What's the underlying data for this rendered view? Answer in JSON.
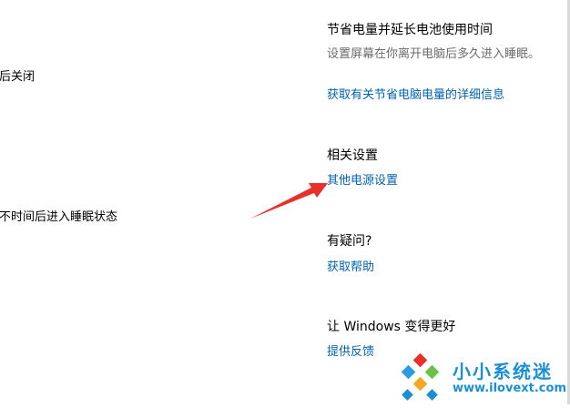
{
  "left": {
    "item1": "后关闭",
    "item2": "不时间后进入睡眠状态"
  },
  "power": {
    "heading": "节省电量并延长电池使用时间",
    "desc": "设置屏幕在你离开电脑后多久进入睡眠。",
    "link": "获取有关节省电脑电量的详细信息"
  },
  "related": {
    "heading": "相关设置",
    "link": "其他电源设置"
  },
  "help": {
    "heading": "有疑问?",
    "link": "获取帮助"
  },
  "feedback": {
    "heading": "让 Windows 变得更好",
    "link": "提供反馈"
  },
  "watermark": {
    "title": "小小系统迷",
    "url": "www.ilovext.com"
  },
  "colors": {
    "link": "#0063b1",
    "arrow": "#e8302a",
    "watermark": "#1a8fd6"
  }
}
